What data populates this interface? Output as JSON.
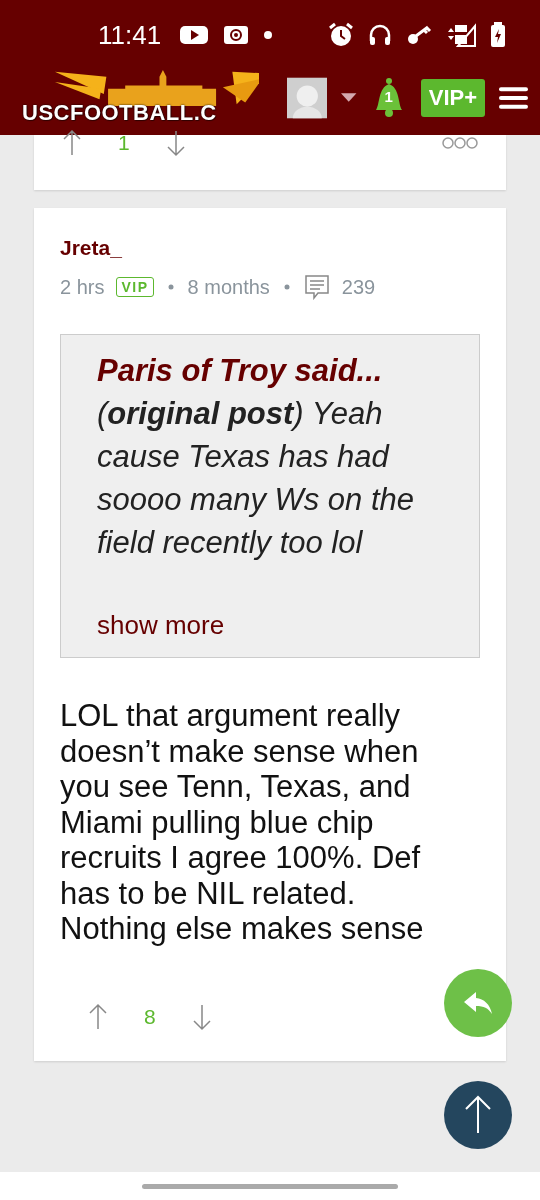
{
  "status_bar": {
    "time": "11:41"
  },
  "header": {
    "logo_text": "USCFOOTBALL.C",
    "notification_count": "1",
    "vip_label": "VIP+"
  },
  "posts": [
    {
      "kind": "footer_only",
      "score": "1"
    },
    {
      "kind": "full",
      "author": "Jreta_",
      "time": "2 hrs",
      "badge": "VIP",
      "tenure": "8 months",
      "post_count": "239",
      "quote": {
        "author": "Paris of Troy said...",
        "body": "(**original post**) Yeah cause Texas has had soooo many Ws on the field recently too lol",
        "more": "show more"
      },
      "body": "LOL that argument really doesn’t make sense when you see Tenn, Texas, and Miami pulling blue chip recruits I agree 100%. Def has to be NIL related. Nothing else makes sense",
      "score": "8"
    }
  ]
}
